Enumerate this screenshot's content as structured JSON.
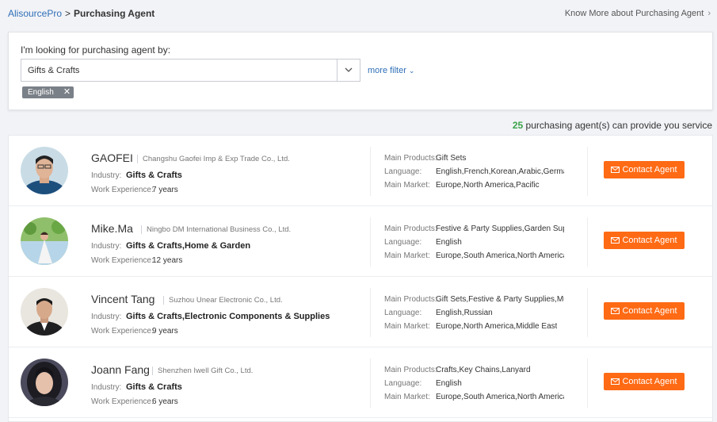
{
  "breadcrumb": {
    "root": "AlisourcePro",
    "sep": ">",
    "current": "Purchasing Agent"
  },
  "know_more": {
    "label": "Know More about Purchasing Agent",
    "chevron": "›"
  },
  "filter": {
    "label": "I'm looking for purchasing agent by:",
    "category": "Gifts & Crafts",
    "more_filter": "more filter",
    "more_filter_chevron": "⌄",
    "tags": [
      {
        "label": "English",
        "remove": "✕"
      }
    ]
  },
  "results": {
    "count": "25",
    "text": "purchasing agent(s) can provide you service"
  },
  "labels": {
    "industry": "Industry:",
    "experience": "Work Experience:",
    "main_products": "Main Products:",
    "language": "Language:",
    "main_market": "Main Market:",
    "contact": "Contact Agent"
  },
  "agents": [
    {
      "name": "GAOFEI",
      "company": "Changshu Gaofei Imp & Exp Trade Co., Ltd.",
      "industry": "Gifts & Crafts",
      "experience": "7 years",
      "products": "Gift Sets",
      "language": "English,French,Korean,Arabic,German,...",
      "market": "Europe,North America,Pacific"
    },
    {
      "name": "Mike.Ma",
      "company": "Ningbo DM International Business Co., Ltd.",
      "industry": "Gifts & Crafts,Home & Garden",
      "experience": "12 years",
      "products": "Festive & Party Supplies,Garden Suppl...",
      "language": "English",
      "market": "Europe,South America,North America"
    },
    {
      "name": "Vincent Tang",
      "company": "Suzhou Unear Electronic Co., Ltd.",
      "industry": "Gifts & Crafts,Electronic Components & Supplies",
      "experience": "9 years",
      "products": "Gift Sets,Festive & Party Supplies,Mus...",
      "language": "English,Russian",
      "market": "Europe,North America,Middle East"
    },
    {
      "name": "Joann Fang",
      "company": "Shenzhen Iwell Gift Co., Ltd.",
      "industry": "Gifts & Crafts",
      "experience": "6 years",
      "products": "Crafts,Key Chains,Lanyard",
      "language": "English",
      "market": "Europe,South America,North America"
    }
  ],
  "colors": {
    "accent": "#ff6a14",
    "link": "#2f6fb7",
    "count": "#3aa34a"
  }
}
